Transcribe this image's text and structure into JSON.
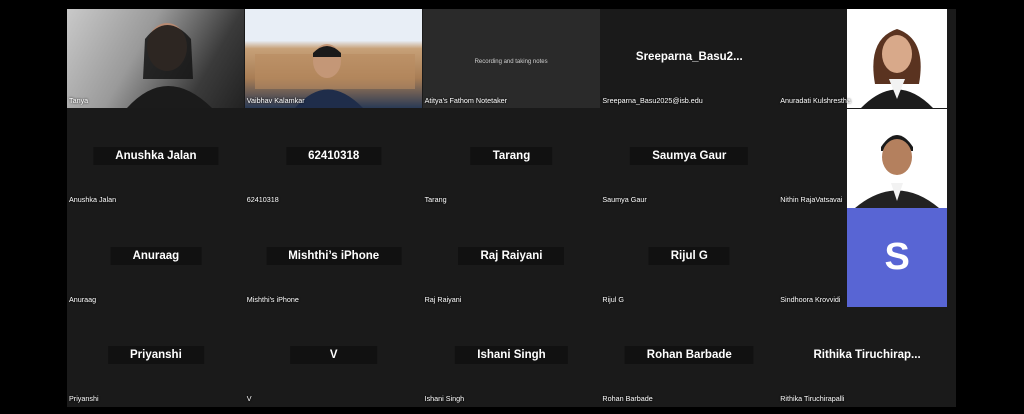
{
  "tiles": [
    {
      "display": "",
      "label": "Tanya",
      "kind": "video-person"
    },
    {
      "display": "",
      "label": "Vaibhav Kalamkar",
      "kind": "video-person"
    },
    {
      "display": "Recording and taking notes",
      "label": "Atitya's Fathom Notetaker",
      "kind": "bot"
    },
    {
      "display": "Sreeparna_Basu2...",
      "label": "Sreeparna_Basu2025@isb.edu",
      "kind": "name"
    },
    {
      "display": "",
      "label": "Anuradati Kulshrestha",
      "kind": "photo"
    },
    {
      "display": "Anushka Jalan",
      "label": "Anushka Jalan",
      "kind": "name"
    },
    {
      "display": "62410318",
      "label": "62410318",
      "kind": "name"
    },
    {
      "display": "Tarang",
      "label": "Tarang",
      "kind": "name"
    },
    {
      "display": "Saumya Gaur",
      "label": "Saumya Gaur",
      "kind": "name"
    },
    {
      "display": "",
      "label": "Nithin RajaVatsavai",
      "kind": "photo"
    },
    {
      "display": "Anuraag",
      "label": "Anuraag",
      "kind": "name"
    },
    {
      "display": "Mishthi’s iPhone",
      "label": "Mishthi's iPhone",
      "kind": "name"
    },
    {
      "display": "Raj Raiyani",
      "label": "Raj Raiyani",
      "kind": "name"
    },
    {
      "display": "Rijul G",
      "label": "Rijul G",
      "kind": "name"
    },
    {
      "display": "S",
      "label": "Sindhoora Krovvidi",
      "kind": "avatar",
      "avatar_color": "#5865d4"
    },
    {
      "display": "Priyanshi",
      "label": "Priyanshi",
      "kind": "name"
    },
    {
      "display": "V",
      "label": "V",
      "kind": "name"
    },
    {
      "display": "Ishani Singh",
      "label": "Ishani Singh",
      "kind": "name"
    },
    {
      "display": "Rohan Barbade",
      "label": "Rohan Barbade",
      "kind": "name"
    },
    {
      "display": "Rithika Tiruchirap...",
      "label": "Rithika Tiruchirapalli",
      "kind": "name"
    }
  ]
}
